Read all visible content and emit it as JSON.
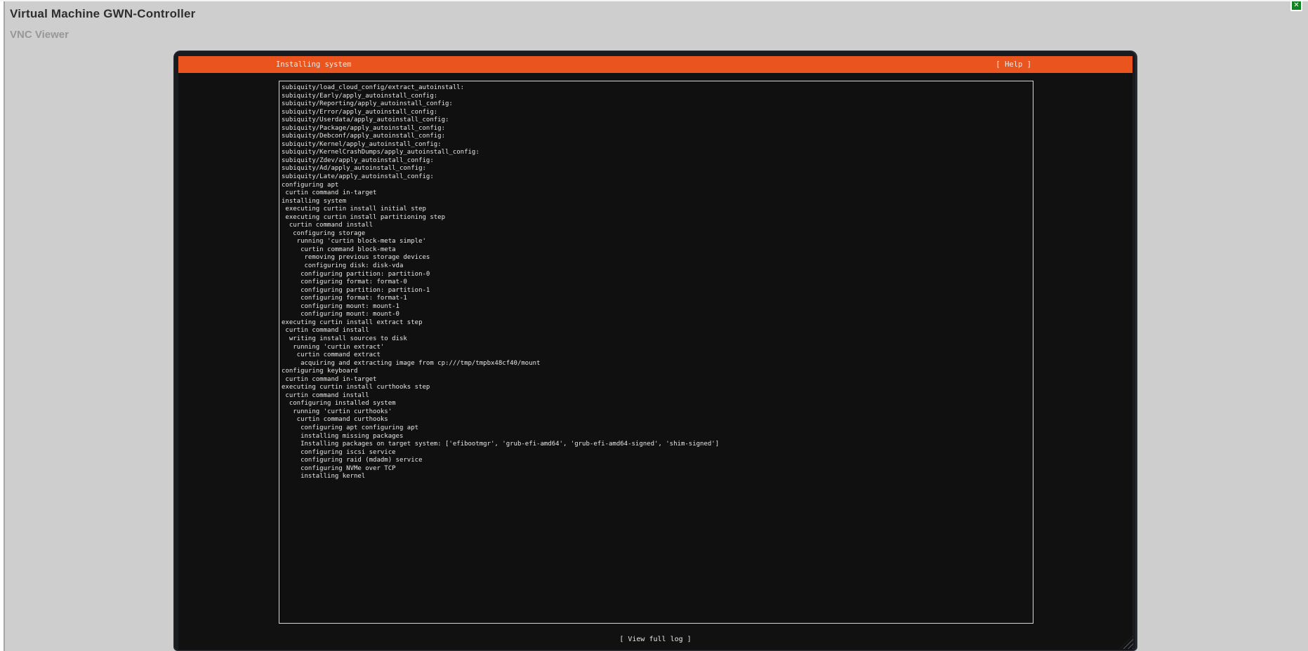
{
  "page": {
    "title": "Virtual Machine GWN-Controller",
    "subtitle": "VNC Viewer"
  },
  "close_button": {
    "glyph": "✕"
  },
  "vnc": {
    "titlebar": {
      "title": "Installing system",
      "help_label": "[ Help ]"
    },
    "view_full_log_label": "[ View full log ]",
    "log_lines": [
      "subiquity/load_cloud_config/extract_autoinstall:",
      "subiquity/Early/apply_autoinstall_config:",
      "subiquity/Reporting/apply_autoinstall_config:",
      "subiquity/Error/apply_autoinstall_config:",
      "subiquity/Userdata/apply_autoinstall_config:",
      "subiquity/Package/apply_autoinstall_config:",
      "subiquity/Debconf/apply_autoinstall_config:",
      "subiquity/Kernel/apply_autoinstall_config:",
      "subiquity/KernelCrashDumps/apply_autoinstall_config:",
      "subiquity/Zdev/apply_autoinstall_config:",
      "subiquity/Ad/apply_autoinstall_config:",
      "subiquity/Late/apply_autoinstall_config:",
      "configuring apt",
      " curtin command in-target",
      "installing system",
      " executing curtin install initial step",
      " executing curtin install partitioning step",
      "  curtin command install",
      "   configuring storage",
      "    running 'curtin block-meta simple'",
      "     curtin command block-meta",
      "      removing previous storage devices",
      "      configuring disk: disk-vda",
      "     configuring partition: partition-0",
      "     configuring format: format-0",
      "     configuring partition: partition-1",
      "     configuring format: format-1",
      "     configuring mount: mount-1",
      "     configuring mount: mount-0",
      "executing curtin install extract step",
      " curtin command install",
      "  writing install sources to disk",
      "   running 'curtin extract'",
      "    curtin command extract",
      "     acquiring and extracting image from cp:///tmp/tmpbx48cf40/mount",
      "configuring keyboard",
      " curtin command in-target",
      "executing curtin install curthooks step",
      " curtin command install",
      "  configuring installed system",
      "   running 'curtin curthooks'",
      "    curtin command curthooks",
      "     configuring apt configuring apt",
      "     installing missing packages",
      "     Installing packages on target system: ['efibootmgr', 'grub-efi-amd64', 'grub-efi-amd64-signed', 'shim-signed']",
      "     configuring iscsi service",
      "     configuring raid (mdadm) service",
      "     configuring NVMe over TCP",
      "     installing kernel"
    ]
  },
  "colors": {
    "accent_orange": "#e9541f",
    "close_green": "#0e8420",
    "terminal_bg": "#111111",
    "page_bg": "#cecece"
  }
}
